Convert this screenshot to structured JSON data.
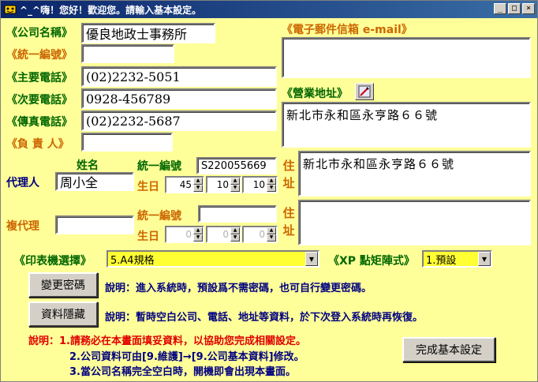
{
  "window": {
    "title": "^_^嗨！您好！歡迎您。請輸入基本設定。",
    "minimize": "_",
    "maximize": "□",
    "close": "×"
  },
  "company": {
    "name_label": "《公司名稱》",
    "name_value": "優良地政士事務所",
    "tax_id_label": "《統一編號》",
    "tax_id_value": "",
    "phone_main_label": "《主要電話》",
    "phone_main_value": "(02)2232-5051",
    "phone_alt_label": "《次要電話》",
    "phone_alt_value": "0928-456789",
    "fax_label": "《傳真電話》",
    "fax_value": "(02)2232-5687",
    "owner_label": "《負 責 人》",
    "owner_value": ""
  },
  "email": {
    "label": "《電子郵件信箱 e-mail》",
    "value": ""
  },
  "business_address": {
    "label": "《營業地址》",
    "value": "新北市永和區永亨路６６號"
  },
  "agent": {
    "label": "代理人",
    "name_header": "姓名",
    "name_value": "周小全",
    "id_label": "統一編號",
    "id_value": "S220055669",
    "birth_label": "生日",
    "birth_year": "45",
    "birth_month": "10",
    "birth_day": "10",
    "addr_label_1": "住",
    "addr_label_2": "址",
    "address": "新北市永和區永亨路６６號"
  },
  "co_agent": {
    "label": "複代理",
    "name_value": "",
    "id_label": "統一編號",
    "id_value": "",
    "birth_label": "生日",
    "birth_year": "0",
    "birth_month": "0",
    "birth_day": "0",
    "addr_label_1": "住",
    "addr_label_2": "址",
    "address": ""
  },
  "printer": {
    "label": "《印表機選擇》",
    "value": "5.A4規格",
    "xp_label": "《XP 點矩陣式》",
    "xp_value": "1.預設"
  },
  "buttons": {
    "change_password": "變更密碼",
    "hide_data": "資料隱藏",
    "finish": "完成基本設定"
  },
  "notes": {
    "change_password": "說明：進入系統時，預設爲不需密碼，也可自行變更密碼。",
    "hide_data": "說明：暫時空白公司、電話、地址等資料，於下次登入系統時再恢復。",
    "line1": "說明：1.請務必在本畫面填妥資料，以協助您完成相關設定。",
    "line2": "2.公司資料可由[9.維護]→[9.公司基本資料]修改。",
    "line3": "3.當公司名稱完全空白時，開機即會出現本畫面。"
  }
}
